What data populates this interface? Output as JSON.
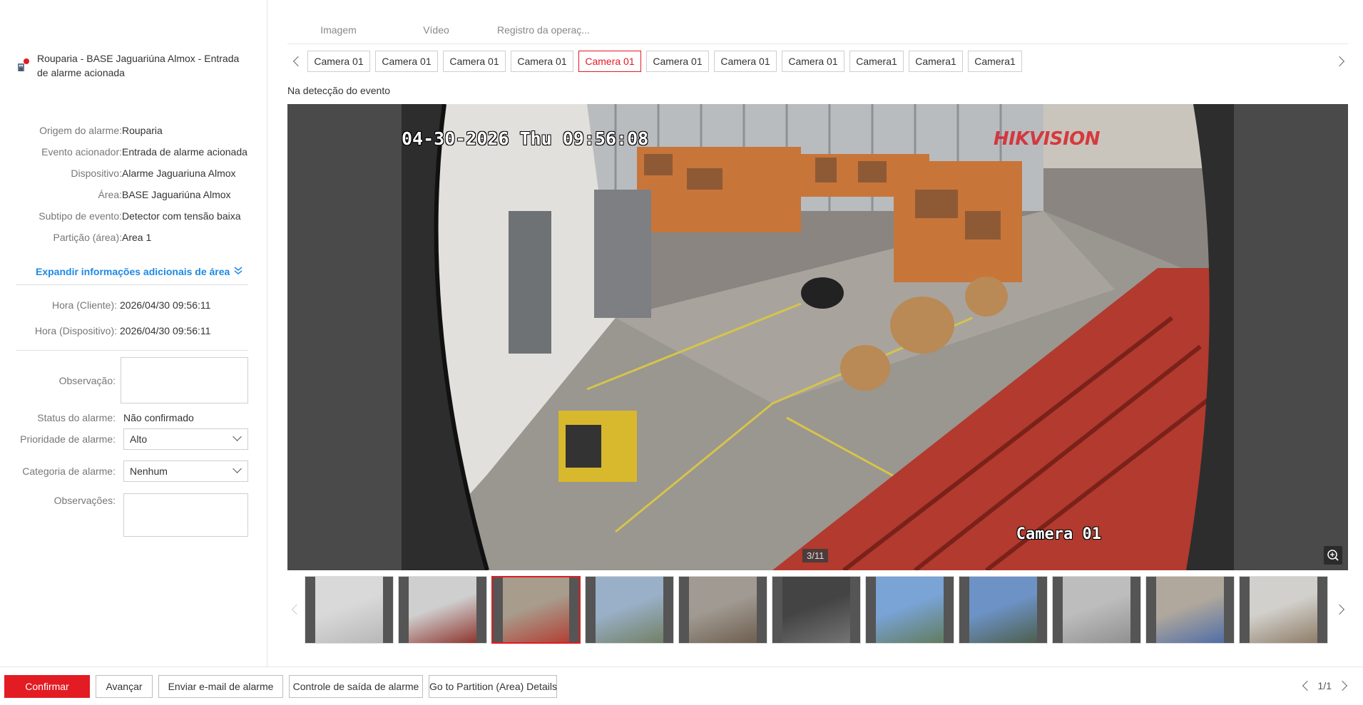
{
  "alarm": {
    "title": "Rouparia - BASE Jaguariúna Almox - Entrada de alarme acionada"
  },
  "details": [
    {
      "label": "Origem do alarme:",
      "value": "Rouparia"
    },
    {
      "label": "Evento acionador:",
      "value": "Entrada de alarme acionada"
    },
    {
      "label": "Dispositivo:",
      "value": "Alarme Jaguariuna Almox"
    },
    {
      "label": "Área:",
      "value": "BASE Jaguariúna Almox"
    },
    {
      "label": "Subtipo de evento:",
      "value": "Detector com tensão baixa"
    },
    {
      "label": "Partição (área):",
      "value": "Area 1"
    }
  ],
  "expand_label": "Expandir informações adicionais de área",
  "times": [
    {
      "label": "Hora (Cliente):",
      "value": "2026/04/30 09:56:11"
    },
    {
      "label": "Hora (Dispositivo):",
      "value": "2026/04/30 09:56:11"
    }
  ],
  "form": {
    "observacao_label": "Observação:",
    "status_label": "Status do alarme:",
    "status_value": "Não confirmado",
    "priority_label": "Prioridade de alarme:",
    "priority_value": "Alto",
    "category_label": "Categoria de alarme:",
    "category_value": "Nenhum",
    "observacoes_label": "Observações:"
  },
  "tabs": [
    {
      "label": "Imagem",
      "active": true
    },
    {
      "label": "Vídeo",
      "active": false
    },
    {
      "label": "Registro da operaç...",
      "active": false
    }
  ],
  "cameras": [
    {
      "label": "Camera 01",
      "active": false
    },
    {
      "label": "Camera 01",
      "active": false
    },
    {
      "label": "Camera 01",
      "active": false
    },
    {
      "label": "Camera 01",
      "active": false
    },
    {
      "label": "Camera 01",
      "active": true
    },
    {
      "label": "Camera 01",
      "active": false
    },
    {
      "label": "Camera 01",
      "active": false
    },
    {
      "label": "Camera 01",
      "active": false
    },
    {
      "label": "Camera1",
      "active": false
    },
    {
      "label": "Camera1",
      "active": false
    },
    {
      "label": "Camera1",
      "active": false
    }
  ],
  "detection_label": "Na detecção do evento",
  "viewer": {
    "timestamp": "04-30-2026 Thu 09:56:08",
    "brand": "HIKVISION",
    "camera_name": "Camera 01",
    "counter": "3/11"
  },
  "thumbnails": [
    {
      "active": false
    },
    {
      "active": false
    },
    {
      "active": true
    },
    {
      "active": false
    },
    {
      "active": false
    },
    {
      "active": false
    },
    {
      "active": false
    },
    {
      "active": false
    },
    {
      "active": false
    },
    {
      "active": false
    },
    {
      "active": false
    }
  ],
  "toolbar": {
    "confirm": "Confirmar",
    "advance": "Avançar",
    "email": "Enviar e-mail de alarme",
    "output": "Controle de saída de alarme",
    "partition": "Go to Partition (Area) Details",
    "page": "1/1"
  },
  "colors": {
    "accent": "#e31b23",
    "link": "#1e88e5"
  }
}
